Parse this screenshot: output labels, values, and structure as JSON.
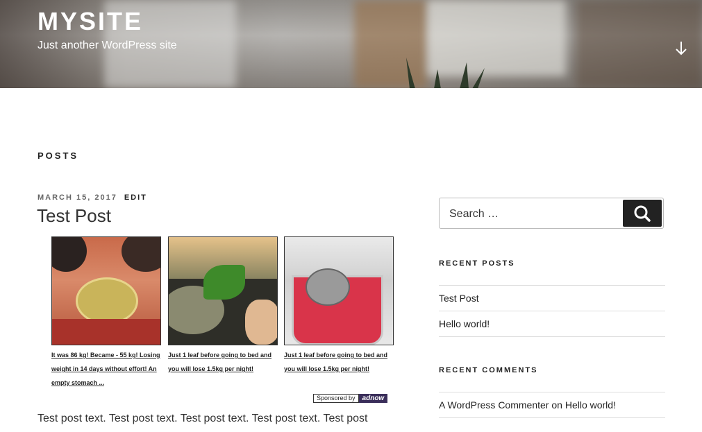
{
  "site": {
    "title": "MYSITE",
    "description": "Just another WordPress site"
  },
  "main": {
    "section_heading": "POSTS",
    "post": {
      "date": "MARCH 15, 2017",
      "edit_label": "EDIT",
      "title": "Test Post",
      "body": "Test post text. Test post text. Test post text. Test post text. Test post"
    },
    "ads": [
      {
        "text": "It was 86 kg! Became - 55 kg! Losing weight in 14 days without effort! An empty stomach ..."
      },
      {
        "text": "Just 1 leaf before going to bed and you will lose 1.5kg per night!"
      },
      {
        "text": "Just 1 leaf before going to bed and you will lose 1.5kg per night!"
      }
    ],
    "sponsored": {
      "label": "Sponsored by",
      "brand": "adnow"
    }
  },
  "sidebar": {
    "search": {
      "placeholder": "Search …"
    },
    "recent_posts": {
      "title": "RECENT POSTS",
      "items": [
        "Test Post",
        "Hello world!"
      ]
    },
    "recent_comments": {
      "title": "RECENT COMMENTS",
      "items": [
        {
          "author": "A WordPress Commenter",
          "on": "on",
          "post": "Hello world!"
        }
      ]
    }
  },
  "colors": {
    "accent": "#222222",
    "adnow": "#3a2e5a"
  }
}
